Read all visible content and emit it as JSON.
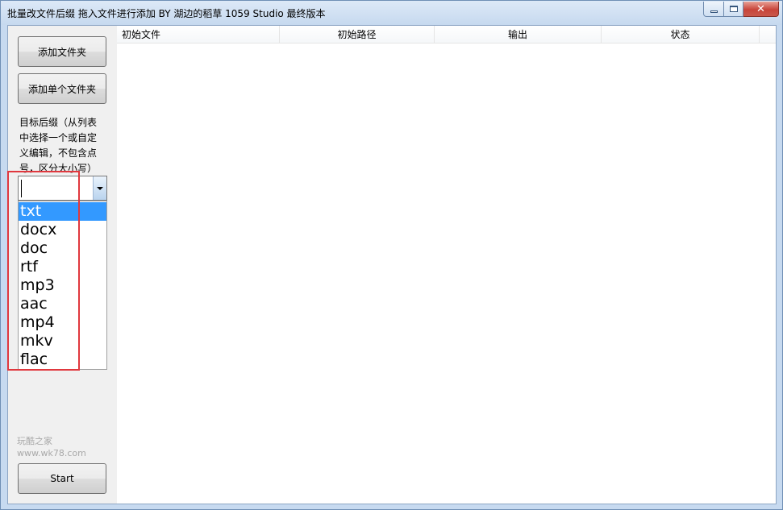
{
  "window": {
    "title": "批量改文件后缀    拖入文件进行添加    BY 湖边的稻草 1059 Studio 最终版本",
    "minimize_glyph": "",
    "maximize_glyph": "",
    "close_glyph": "✕"
  },
  "left_panel": {
    "add_folder_label": "添加文件夹",
    "add_file_label": "添加单个文件夹",
    "suffix_label": "目标后缀（从列表中选择一个或自定义编辑，不包含点号，区分大小写）",
    "combo_value": "",
    "dropdown_items": [
      "txt",
      "docx",
      "doc",
      "rtf",
      "mp3",
      "aac",
      "mp4",
      "mkv",
      "flac"
    ],
    "selected_item": "txt",
    "watermark_line1": "玩酷之家",
    "watermark_line2": "www.wk78.com",
    "start_label": "Start"
  },
  "list_view": {
    "columns": [
      "初始文件",
      "初始路径",
      "输出",
      "状态"
    ]
  },
  "colors": {
    "selection": "#3399ff",
    "highlight_box": "#e0383e",
    "watermark": "#a9a9a9"
  },
  "icons": {
    "combo_arrow": "chevron-down-icon",
    "minimize": "minimize-icon",
    "maximize": "maximize-icon",
    "close": "close-icon"
  }
}
